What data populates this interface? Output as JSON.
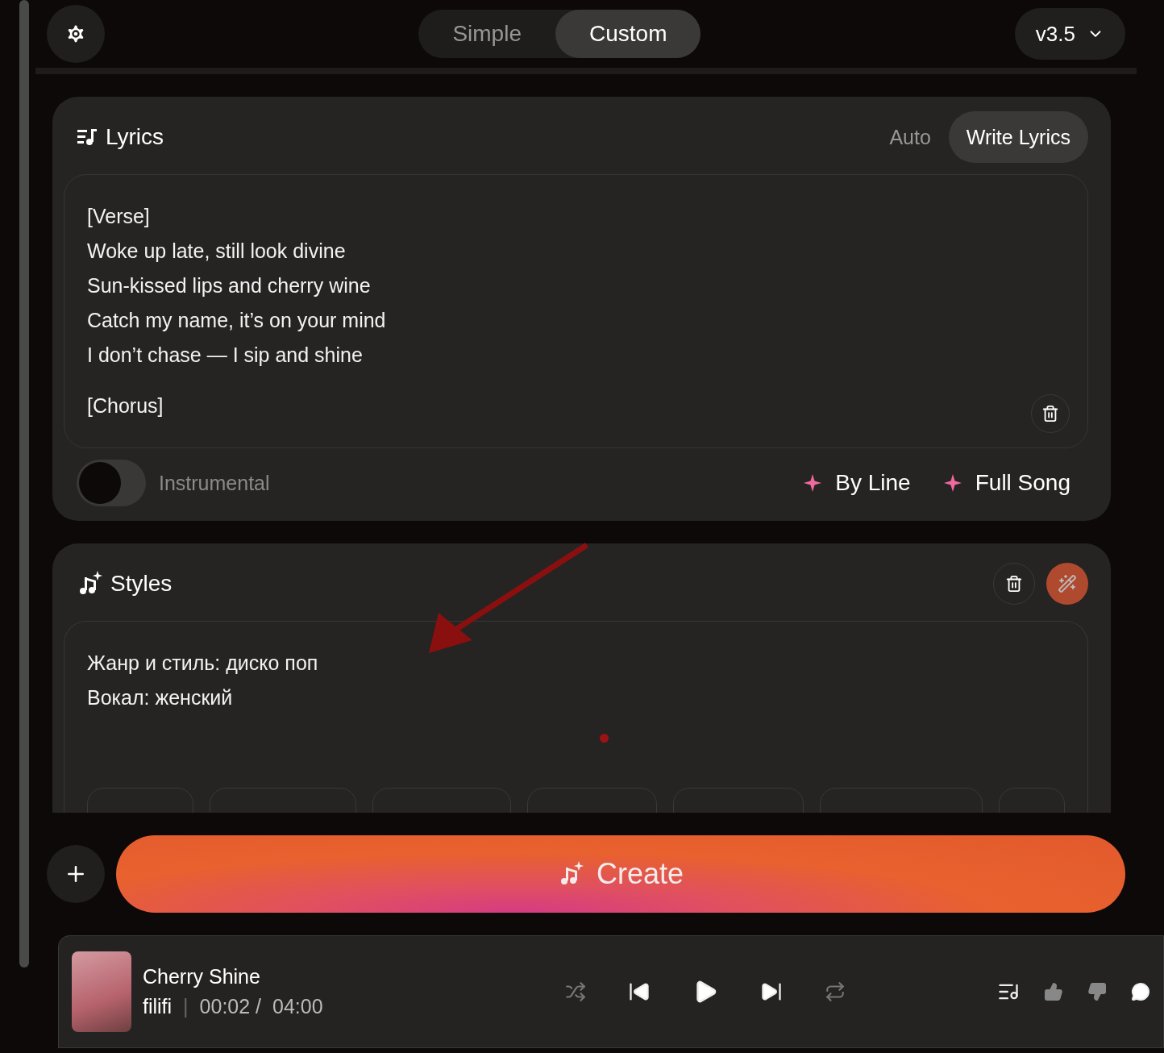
{
  "header": {
    "modes": [
      {
        "label": "Simple",
        "selected": false
      },
      {
        "label": "Custom",
        "selected": true
      }
    ],
    "version": "v3.5"
  },
  "lyrics": {
    "title": "Lyrics",
    "modes": [
      {
        "label": "Auto",
        "selected": false
      },
      {
        "label": "Write Lyrics",
        "selected": true
      }
    ],
    "stanzas": [
      [
        "[Verse]",
        "Woke up late, still look divine",
        "Sun-kissed lips and cherry wine",
        "Catch my name, it’s on your mind",
        "I don’t chase — I sip and shine"
      ],
      [
        "[Chorus]"
      ]
    ],
    "instrumental": {
      "label": "Instrumental",
      "on": false
    },
    "actions": [
      "By Line",
      "Full Song"
    ]
  },
  "styles": {
    "title": "Styles",
    "lines": [
      "Жанр и стиль:  диско поп",
      "Вокал: женский"
    ]
  },
  "create": {
    "label": "Create"
  },
  "player": {
    "title": "Cherry Shine",
    "artist": "filifi",
    "separator": "|",
    "elapsed": "00:02 /",
    "total": "04:00"
  }
}
